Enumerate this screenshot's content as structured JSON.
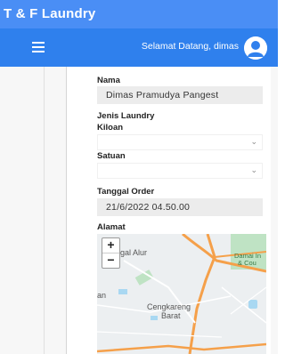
{
  "app": {
    "title": "T & F Laundry"
  },
  "navbar": {
    "welcome": "Selamat Datang, dimas",
    "menu_icon": "hamburger-menu-icon",
    "avatar_icon": "user-avatar-icon"
  },
  "form": {
    "nama_label": "Nama",
    "nama_value": "Dimas Pramudya Pangest",
    "jenis_label": "Jenis Laundry",
    "kiloan_label": "Kiloan",
    "kiloan_value": "",
    "satuan_label": "Satuan",
    "satuan_value": "",
    "tanggal_label": "Tanggal Order",
    "tanggal_value": "21/6/2022 04.50.00",
    "alamat_label": "Alamat"
  },
  "map": {
    "zoom_in": "+",
    "zoom_out": "−",
    "labels": [
      "gal Alur",
      "Damai In",
      "& Cou",
      "an",
      "Cengkareng",
      "Barat"
    ]
  },
  "colors": {
    "titlebar": "#4a8ef5",
    "navbar": "#2f80ed",
    "road": "#f5a04a",
    "park": "#bfe3c4"
  }
}
